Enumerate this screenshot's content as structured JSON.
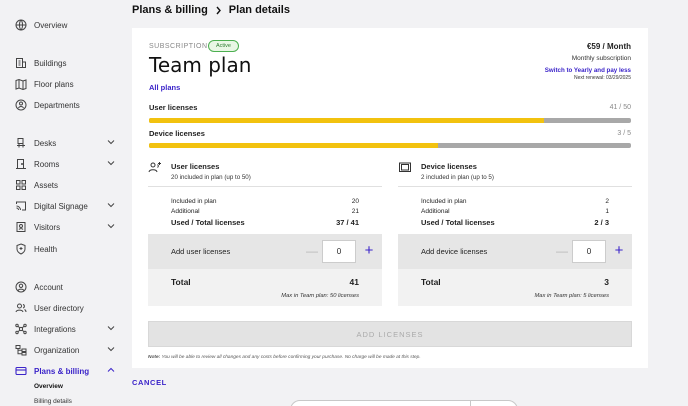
{
  "breadcrumb": {
    "root": "Plans & billing",
    "current": "Plan details"
  },
  "sidebar": {
    "items": [
      {
        "label": "Overview",
        "icon": "globe-icon"
      },
      {
        "label": "Buildings",
        "icon": "building-icon"
      },
      {
        "label": "Floor plans",
        "icon": "map-icon"
      },
      {
        "label": "Departments",
        "icon": "departments-icon"
      },
      {
        "label": "Desks",
        "icon": "desk-icon"
      },
      {
        "label": "Rooms",
        "icon": "door-icon"
      },
      {
        "label": "Assets",
        "icon": "grid-icon"
      },
      {
        "label": "Digital Signage",
        "icon": "cast-icon"
      },
      {
        "label": "Visitors",
        "icon": "visitors-icon"
      },
      {
        "label": "Health",
        "icon": "shield-icon"
      },
      {
        "label": "Account",
        "icon": "user-circle-icon"
      },
      {
        "label": "User directory",
        "icon": "users-icon"
      },
      {
        "label": "Integrations",
        "icon": "integrations-icon"
      },
      {
        "label": "Organization",
        "icon": "org-icon"
      },
      {
        "label": "Plans & billing",
        "icon": "card-icon"
      }
    ],
    "sub_items": [
      "Overview",
      "Billing details"
    ]
  },
  "plan": {
    "section_label": "SUBSCRIPTION",
    "status": "Active",
    "name": "Team plan",
    "all_plans": "All plans",
    "price": "€59 / Month",
    "billing": "Monthly subscription",
    "switch_link": "Switch to Yearly and pay less",
    "renewal": "Next renewal: 03/29/2025"
  },
  "usage": {
    "users": {
      "label": "User licenses",
      "count": "41 / 50",
      "fraction": 0.82
    },
    "devices": {
      "label": "Device licenses",
      "count": "3 / 5",
      "fraction": 0.6
    }
  },
  "user_panel": {
    "title": "User licenses",
    "subtitle": "20 included in plan (up to 50)",
    "rows": [
      {
        "label": "Included in plan",
        "value": "20"
      },
      {
        "label": "Additional",
        "value": "21"
      },
      {
        "label": "Used / Total licenses",
        "value": "37 / 41"
      }
    ],
    "add_label": "Add user licenses",
    "qty": "0",
    "total_label": "Total",
    "total": "41",
    "max": "Max in Team plan: 50 licenses"
  },
  "device_panel": {
    "title": "Device licenses",
    "subtitle": "2 included in plan (up to 5)",
    "rows": [
      {
        "label": "Included in plan",
        "value": "2"
      },
      {
        "label": "Additional",
        "value": "1"
      },
      {
        "label": "Used / Total licenses",
        "value": "2 / 3"
      }
    ],
    "add_label": "Add device licenses",
    "qty": "0",
    "total_label": "Total",
    "total": "3",
    "max": "Max in Team plan: 5 licenses"
  },
  "actions": {
    "add_licenses": "ADD LICENSES",
    "note_label": "Note:",
    "note": "You will be able to review all changes and any costs before confirming your purchase. No charge will be made at this step.",
    "cancel": "CANCEL",
    "minus": "—",
    "plus": "+"
  },
  "colors": {
    "accent": "#3b24c9",
    "bar_fill": "#f2c20f",
    "bar_track": "#a8a8a8",
    "active_badge": "#4caf50"
  }
}
